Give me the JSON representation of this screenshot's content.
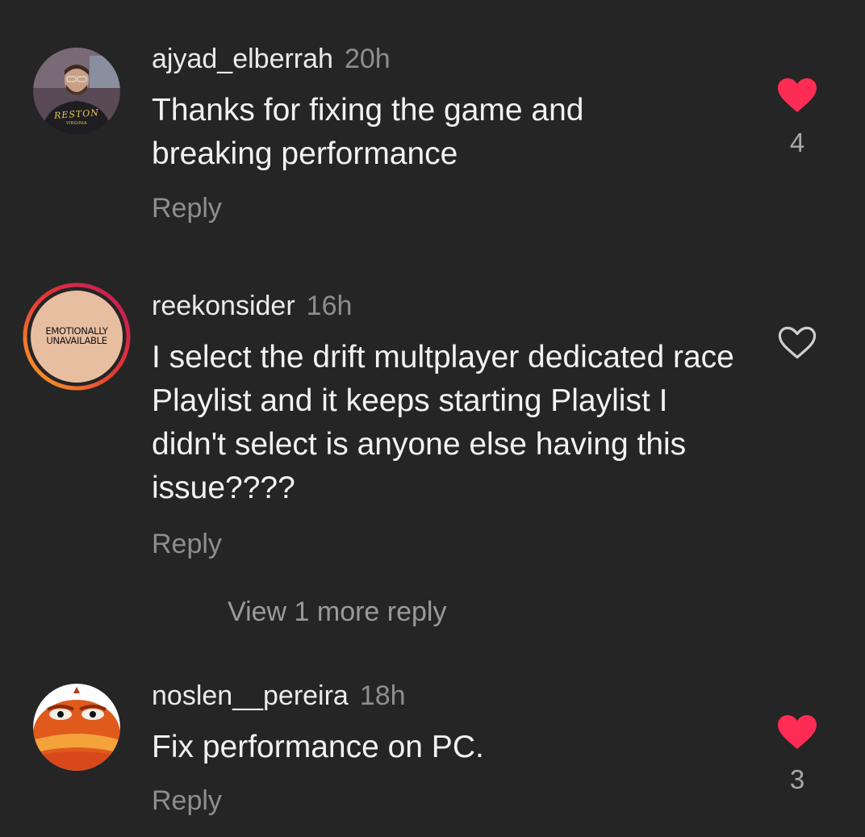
{
  "comments": [
    {
      "username": "ajyad_elberrah",
      "time": "20h",
      "text": "Thanks for fixing the game and breaking performance",
      "reply_label": "Reply",
      "liked": true,
      "like_count": "4",
      "avatar_shirt_text": "RESTON",
      "avatar_shirt_subtext": "VIRGINIA"
    },
    {
      "username": "reekonsider",
      "time": "16h",
      "text": "I select the drift multplayer dedicated race Playlist and it keeps starting Playlist I didn't select is anyone else having this issue????",
      "reply_label": "Reply",
      "liked": false,
      "avatar_text_line1": "EMOTIONALLY",
      "avatar_text_line2": "UNAVAILABLE"
    },
    {
      "username": "noslen__pereira",
      "time": "18h",
      "text": "Fix performance on PC.",
      "reply_label": "Reply",
      "liked": true,
      "like_count": "3"
    }
  ],
  "view_more_label": "View 1 more reply",
  "colors": {
    "background": "#252525",
    "like_red": "#fe2c55",
    "story_ring_start": "#f9a825",
    "story_ring_end": "#c2185b"
  },
  "icons": [
    "heart-filled-icon",
    "heart-outline-icon"
  ]
}
